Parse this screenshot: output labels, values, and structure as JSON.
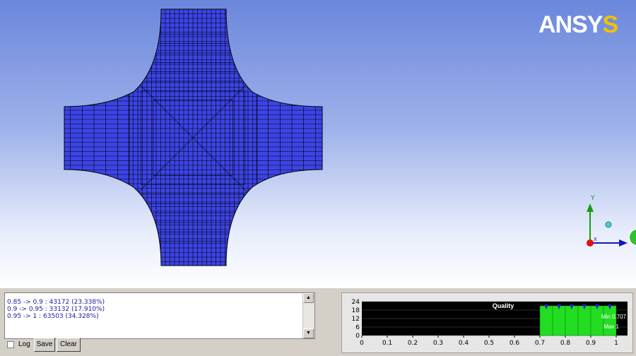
{
  "logo": {
    "text_main": "ANSY",
    "text_accent": "S"
  },
  "colors": {
    "mesh_fill": "#3c44e6",
    "mesh_line": "#000000",
    "hist_bar": "#22dd22",
    "hist_marker": "#2222cc",
    "hist_bg": "#000000",
    "y_axis": "#12a012",
    "x_axis": "#1414c8",
    "origin": "#dd1010"
  },
  "axes": {
    "y_label": "Y",
    "x_label": "X"
  },
  "log": {
    "lines": [
      "0.85 -> 0.9 : 43172 (23.338%)",
      "0.9 -> 0.95 : 33132 (17.910%)",
      "0.95 -> 1 : 63503 (34.328%)"
    ]
  },
  "controls": {
    "log_label": "Log",
    "save_label": "Save",
    "clear_label": "Clear",
    "log_checked": false
  },
  "chart_data": {
    "type": "bar",
    "title": "Quality",
    "x_ticks": [
      "0",
      "0.1",
      "0.2",
      "0.3",
      "0.4",
      "0.5",
      "0.6",
      "0.7",
      "0.8",
      "0.9",
      "1"
    ],
    "y_ticks": [
      "24",
      "18",
      "12",
      "6",
      "0"
    ],
    "ylim": [
      0,
      24
    ],
    "xlim": [
      0,
      1
    ],
    "bars_x": [
      0.7,
      0.75,
      0.8,
      0.85,
      0.9,
      0.95
    ],
    "bars_values": [
      21,
      21,
      21,
      21,
      21,
      21
    ],
    "min_text": "Min 0.707",
    "max_text": "Max 1"
  }
}
